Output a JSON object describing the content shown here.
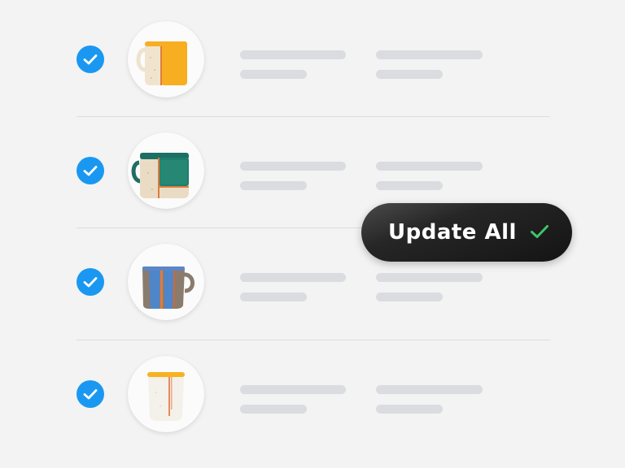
{
  "items": [
    {
      "selected": true,
      "product": "mug-orange"
    },
    {
      "selected": true,
      "product": "mug-teal"
    },
    {
      "selected": true,
      "product": "mug-blue-stripe"
    },
    {
      "selected": true,
      "product": "cup-white-yellow"
    }
  ],
  "update_button": {
    "label": "Update All",
    "icon": "check-icon"
  },
  "colors": {
    "checkbox": "#1a98f1",
    "placeholder": "#dadcdf",
    "button_bg": "#1e1e1e",
    "button_check": "#3fc46b"
  }
}
